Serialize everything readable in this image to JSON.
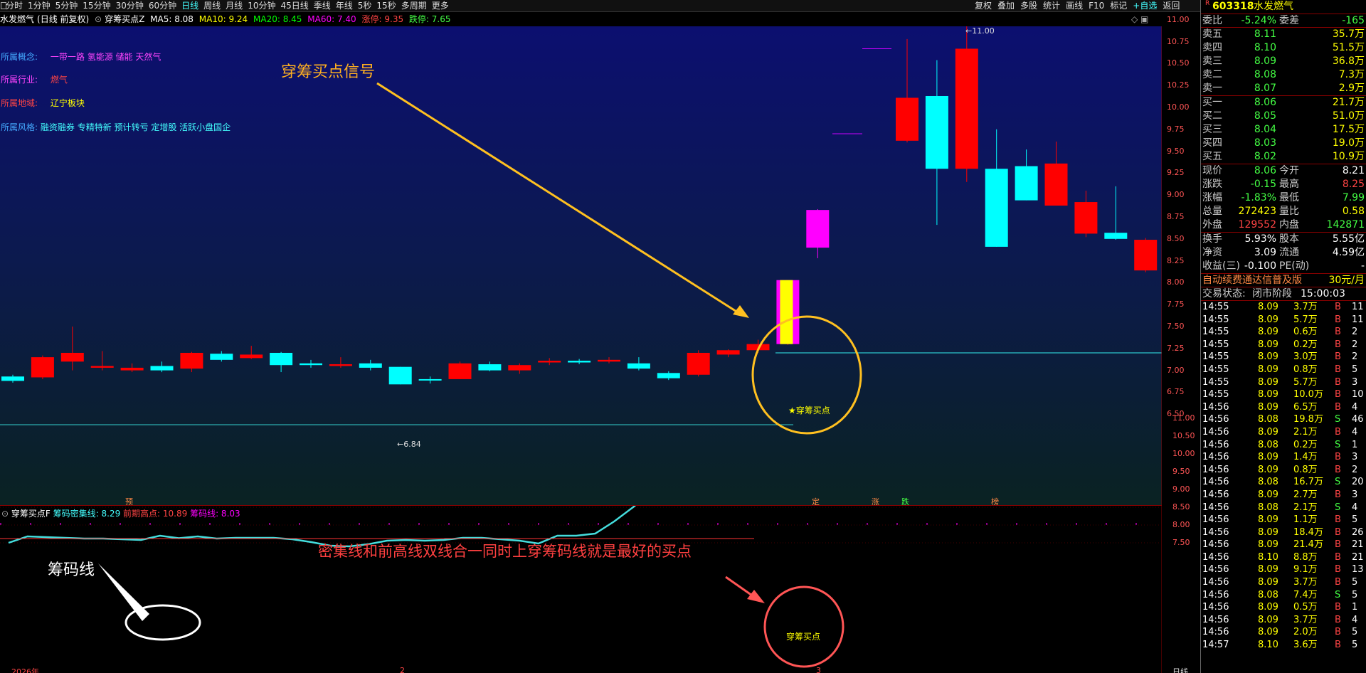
{
  "toolbar": {
    "icon": "window-menu-icon",
    "periods": [
      "分时",
      "1分钟",
      "5分钟",
      "15分钟",
      "30分钟",
      "60分钟",
      "日线",
      "周线",
      "月线",
      "10分钟",
      "45日线",
      "季线",
      "年线",
      "5秒",
      "15秒",
      "多周期",
      "更多"
    ],
    "active": "日线",
    "right": [
      "复权",
      "叠加",
      "多股",
      "统计",
      "画线",
      "F10",
      "标记",
      "+自选",
      "返回"
    ]
  },
  "chart_header": {
    "name": "水发燃气",
    "mode": "(日线 前复权)",
    "indicator": "穿筹买点Z",
    "ma5": "MA5: 8.08",
    "ma10": "MA10: 9.24",
    "ma20": "MA20: 8.45",
    "ma60": "MA60: 7.40",
    "up_limit": "涨停: 9.35",
    "down_limit": "跌停: 7.65"
  },
  "info": [
    {
      "label": "所属概念:",
      "value": "一带一路 氢能源 储能 天然气"
    },
    {
      "label": "所属行业:",
      "value": "燃气"
    },
    {
      "label": "所属地域:",
      "value": "辽宁板块"
    },
    {
      "label": "所属风格:",
      "value": "融资融券 专精特新 预计转亏 定增股 活跃小盘国企"
    }
  ],
  "annotations": {
    "signal_title": "穿筹买点信号",
    "buy_point_label": "★穿筹买点",
    "low_mark": "6.84",
    "high_mark": "11.00",
    "chip_line": "筹码线",
    "sub_title_note": "密集线和前高线双线合一同时上穿筹码线就是最好的买点",
    "sub_buy_label": "穿筹买点",
    "markers": [
      "预",
      "定",
      "涨",
      "跌",
      "榜"
    ]
  },
  "sub_header": {
    "name": "穿筹买点F",
    "dense": "筹码密集线: 8.29",
    "prev_high": "前期高点: 10.89",
    "chip": "筹码线: 8.03"
  },
  "x_axis": {
    "year": "2026年",
    "m2": "2",
    "m3": "3",
    "period": "日线"
  },
  "chart_data": {
    "type": "candlestick",
    "main_yticks": [
      6.5,
      6.75,
      7.0,
      7.25,
      7.5,
      7.75,
      8.0,
      8.25,
      8.5,
      8.75,
      9.0,
      9.25,
      9.5,
      9.75,
      10.0,
      10.25,
      10.5,
      10.75,
      11.0
    ],
    "sub_yticks": [
      7.5,
      8.0,
      8.5,
      9.0,
      9.5,
      10.0,
      10.5,
      11.0
    ],
    "candles": [
      {
        "o": 6.93,
        "c": 6.88,
        "h": 6.95,
        "l": 6.86
      },
      {
        "o": 6.92,
        "c": 7.15,
        "h": 7.17,
        "l": 6.9
      },
      {
        "o": 7.1,
        "c": 7.2,
        "h": 7.5,
        "l": 7.0
      },
      {
        "o": 7.03,
        "c": 7.05,
        "h": 7.22,
        "l": 7.0
      },
      {
        "o": 7.0,
        "c": 7.03,
        "h": 7.08,
        "l": 6.98
      },
      {
        "o": 7.05,
        "c": 7.0,
        "h": 7.1,
        "l": 6.98
      },
      {
        "o": 7.02,
        "c": 7.2,
        "h": 7.21,
        "l": 6.98
      },
      {
        "o": 7.19,
        "c": 7.12,
        "h": 7.22,
        "l": 7.1
      },
      {
        "o": 7.14,
        "c": 7.18,
        "h": 7.28,
        "l": 7.13
      },
      {
        "o": 7.2,
        "c": 7.06,
        "h": 7.21,
        "l": 6.98
      },
      {
        "o": 7.08,
        "c": 7.06,
        "h": 7.12,
        "l": 7.03
      },
      {
        "o": 7.05,
        "c": 7.07,
        "h": 7.15,
        "l": 7.03
      },
      {
        "o": 7.08,
        "c": 7.03,
        "h": 7.12,
        "l": 7.0
      },
      {
        "o": 7.04,
        "c": 6.84,
        "h": 7.04,
        "l": 6.84
      },
      {
        "o": 6.9,
        "c": 6.89,
        "h": 6.93,
        "l": 6.85
      },
      {
        "o": 6.9,
        "c": 7.08,
        "h": 7.1,
        "l": 6.9
      },
      {
        "o": 7.07,
        "c": 7.0,
        "h": 7.1,
        "l": 6.99
      },
      {
        "o": 7.0,
        "c": 7.06,
        "h": 7.08,
        "l": 6.96
      },
      {
        "o": 7.09,
        "c": 7.11,
        "h": 7.14,
        "l": 7.06
      },
      {
        "o": 7.11,
        "c": 7.09,
        "h": 7.13,
        "l": 7.07
      },
      {
        "o": 7.1,
        "c": 7.12,
        "h": 7.15,
        "l": 7.08
      },
      {
        "o": 7.08,
        "c": 7.02,
        "h": 7.15,
        "l": 7.0
      },
      {
        "o": 6.97,
        "c": 6.91,
        "h": 6.99,
        "l": 6.89
      },
      {
        "o": 6.95,
        "c": 7.2,
        "h": 7.23,
        "l": 6.93
      },
      {
        "o": 7.18,
        "c": 7.23,
        "h": 7.24,
        "l": 7.15
      },
      {
        "o": 7.23,
        "c": 7.3,
        "h": 7.35,
        "l": 7.2
      },
      {
        "o": 7.3,
        "c": 8.03,
        "h": 8.03,
        "l": 7.29
      },
      {
        "o": 8.4,
        "c": 8.83,
        "h": 8.84,
        "l": 8.28
      },
      {
        "o": 9.7,
        "c": 9.7,
        "h": 9.71,
        "l": 9.69
      },
      {
        "o": 10.67,
        "c": 10.67,
        "h": 10.68,
        "l": 9.87
      },
      {
        "o": 9.62,
        "c": 10.11,
        "h": 10.78,
        "l": 9.6
      },
      {
        "o": 10.13,
        "c": 9.3,
        "h": 10.54,
        "l": 8.66
      },
      {
        "o": 9.3,
        "c": 10.67,
        "h": 11.0,
        "l": 9.15
      },
      {
        "o": 9.3,
        "c": 8.41,
        "h": 9.75,
        "l": 8.41
      },
      {
        "o": 9.33,
        "c": 8.94,
        "h": 9.52,
        "l": 8.94
      },
      {
        "o": 8.88,
        "c": 9.36,
        "h": 9.61,
        "l": 8.88
      },
      {
        "o": 8.56,
        "c": 8.92,
        "h": 9.05,
        "l": 8.52
      },
      {
        "o": 8.57,
        "c": 8.5,
        "h": 9.1,
        "l": 8.49
      },
      {
        "o": 8.14,
        "c": 8.49,
        "h": 8.51,
        "l": 8.12
      }
    ],
    "dense_line": [
      7.5,
      7.68,
      7.66,
      7.64,
      7.62,
      7.62,
      7.6,
      7.58,
      7.7,
      7.63,
      7.68,
      7.62,
      7.64,
      7.64,
      7.64,
      7.6,
      7.52,
      7.42,
      7.4,
      7.46,
      7.56,
      7.58,
      7.56,
      7.58,
      7.64,
      7.64,
      7.6,
      7.56,
      7.48,
      7.7,
      7.7,
      7.76,
      8.1,
      8.5,
      8.95,
      9.4,
      9.84,
      10.4,
      10.89,
      10.18,
      10.43,
      9.95,
      9.95,
      9.95,
      9.96,
      9.68,
      9.48,
      9.4,
      9.2,
      8.94
    ],
    "prev_high_line": 10.89,
    "chip_line": 8.03
  },
  "quote": {
    "code": "603318",
    "name": "水发燃气",
    "wb": {
      "label": "委比",
      "pct": "-5.24%",
      "label2": "委差",
      "diff": "-165"
    },
    "sells": [
      {
        "name": "卖五",
        "p": "8.11",
        "v": "35.7万"
      },
      {
        "name": "卖四",
        "p": "8.10",
        "v": "51.5万"
      },
      {
        "name": "卖三",
        "p": "8.09",
        "v": "36.8万"
      },
      {
        "name": "卖二",
        "p": "8.08",
        "v": "7.3万"
      },
      {
        "name": "卖一",
        "p": "8.07",
        "v": "2.9万"
      }
    ],
    "buys": [
      {
        "name": "买一",
        "p": "8.06",
        "v": "21.7万"
      },
      {
        "name": "买二",
        "p": "8.05",
        "v": "51.0万"
      },
      {
        "name": "买三",
        "p": "8.04",
        "v": "17.5万"
      },
      {
        "name": "买四",
        "p": "8.03",
        "v": "19.0万"
      },
      {
        "name": "买五",
        "p": "8.02",
        "v": "10.9万"
      }
    ],
    "stats": [
      [
        "现价",
        "8.06",
        "今开",
        "8.21"
      ],
      [
        "涨跌",
        "-0.15",
        "最高",
        "8.25"
      ],
      [
        "涨幅",
        "-1.83%",
        "最低",
        "7.99"
      ],
      [
        "总量",
        "272423",
        "量比",
        "0.58"
      ],
      [
        "外盘",
        "129552",
        "内盘",
        "142871"
      ]
    ],
    "stats2": [
      [
        "换手",
        "5.93%",
        "股本",
        "5.55亿"
      ],
      [
        "净资",
        "3.09",
        "流通",
        "4.59亿"
      ],
      [
        "收益(三)",
        "-0.100",
        "PE(动)",
        "-"
      ]
    ],
    "ad": "自动续费通达信普及版",
    "ad_price": "30元/月",
    "status_label": "交易状态:",
    "status": "闭市阶段",
    "status_time": "15:00:03"
  },
  "ticks": [
    [
      "14:55",
      "8.09",
      "3.7万",
      "B",
      "11"
    ],
    [
      "14:55",
      "8.09",
      "5.7万",
      "B",
      "11"
    ],
    [
      "14:55",
      "8.09",
      "0.6万",
      "B",
      "2"
    ],
    [
      "14:55",
      "8.09",
      "0.2万",
      "B",
      "2"
    ],
    [
      "14:55",
      "8.09",
      "3.0万",
      "B",
      "2"
    ],
    [
      "14:55",
      "8.09",
      "0.8万",
      "B",
      "5"
    ],
    [
      "14:55",
      "8.09",
      "5.7万",
      "B",
      "3"
    ],
    [
      "14:55",
      "8.09",
      "10.0万",
      "B",
      "10"
    ],
    [
      "14:56",
      "8.09",
      "6.5万",
      "B",
      "4"
    ],
    [
      "14:56",
      "8.08",
      "19.8万",
      "S",
      "46"
    ],
    [
      "14:56",
      "8.09",
      "2.1万",
      "B",
      "4"
    ],
    [
      "14:56",
      "8.08",
      "0.2万",
      "S",
      "1"
    ],
    [
      "14:56",
      "8.09",
      "1.4万",
      "B",
      "3"
    ],
    [
      "14:56",
      "8.09",
      "0.8万",
      "B",
      "2"
    ],
    [
      "14:56",
      "8.08",
      "16.7万",
      "S",
      "20"
    ],
    [
      "14:56",
      "8.09",
      "2.7万",
      "B",
      "3"
    ],
    [
      "14:56",
      "8.08",
      "2.1万",
      "S",
      "4"
    ],
    [
      "14:56",
      "8.09",
      "1.1万",
      "B",
      "5"
    ],
    [
      "14:56",
      "8.09",
      "18.4万",
      "B",
      "26"
    ],
    [
      "14:56",
      "8.09",
      "21.4万",
      "B",
      "21"
    ],
    [
      "14:56",
      "8.10",
      "8.8万",
      "B",
      "21"
    ],
    [
      "14:56",
      "8.09",
      "9.1万",
      "B",
      "13"
    ],
    [
      "14:56",
      "8.09",
      "3.7万",
      "B",
      "5"
    ],
    [
      "14:56",
      "8.08",
      "7.4万",
      "S",
      "5"
    ],
    [
      "14:56",
      "8.09",
      "0.5万",
      "B",
      "1"
    ],
    [
      "14:56",
      "8.09",
      "3.7万",
      "B",
      "4"
    ],
    [
      "14:56",
      "8.09",
      "2.0万",
      "B",
      "5"
    ],
    [
      "14:57",
      "8.10",
      "3.6万",
      "B",
      "5"
    ]
  ],
  "colors": {
    "up": "#ff0000",
    "down": "#00ffff",
    "signal": "#ffff00",
    "magenta": "#ff00ff",
    "annot": "#ffb020",
    "sub_annot": "#ff4040"
  }
}
